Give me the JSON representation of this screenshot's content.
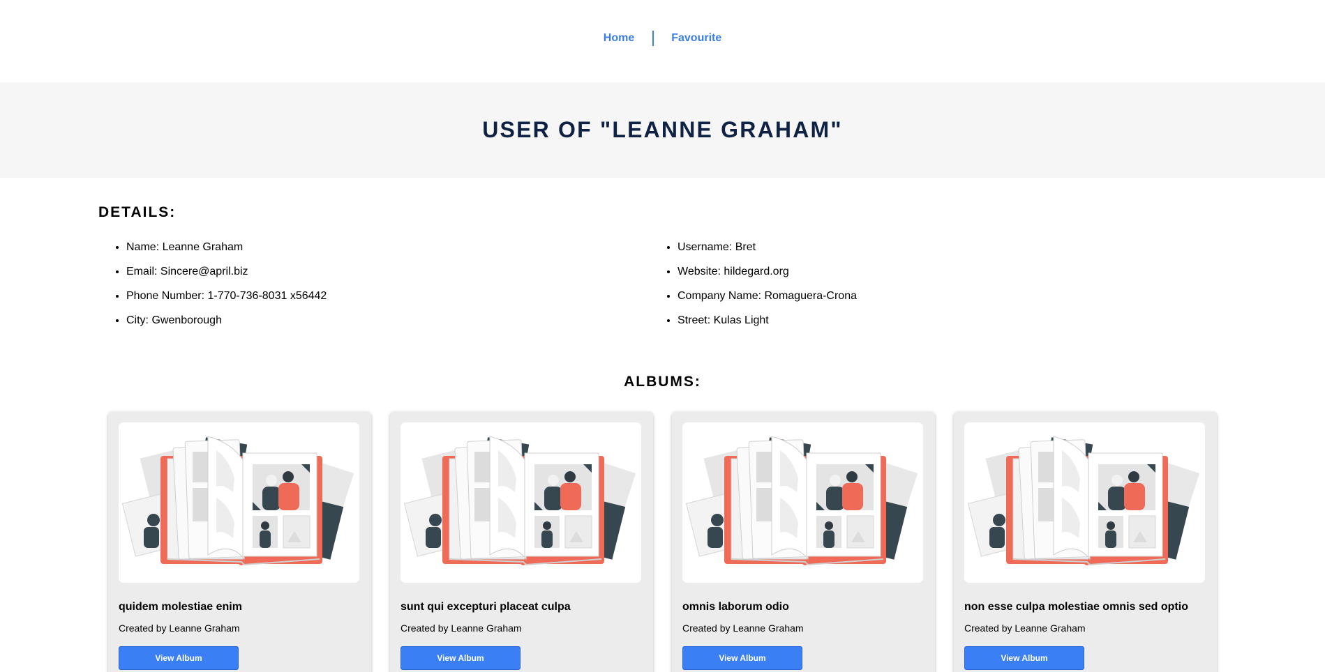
{
  "nav": {
    "home_label": "Home",
    "favourite_label": "Favourite"
  },
  "banner": {
    "title": "USER OF \"LEANNE GRAHAM\""
  },
  "details": {
    "heading": "DETAILS:",
    "left": [
      "Name: Leanne Graham",
      "Email: Sincere@april.biz",
      "Phone Number: 1-770-736-8031 x56442",
      "City: Gwenborough"
    ],
    "right": [
      "Username: Bret",
      "Website: hildegard.org",
      "Company Name: Romaguera-Crona",
      "Street: Kulas Light"
    ]
  },
  "albums": {
    "heading": "ALBUMS:",
    "items": [
      {
        "title": "quidem molestiae enim",
        "created_by": "Created by Leanne Graham",
        "button_label": "View Album",
        "image_icon": "photo-album-illustration"
      },
      {
        "title": "sunt qui excepturi placeat culpa",
        "created_by": "Created by Leanne Graham",
        "button_label": "View Album",
        "image_icon": "photo-album-illustration"
      },
      {
        "title": "omnis laborum odio",
        "created_by": "Created by Leanne Graham",
        "button_label": "View Album",
        "image_icon": "photo-album-illustration"
      },
      {
        "title": "non esse culpa molestiae omnis sed optio",
        "created_by": "Created by Leanne Graham",
        "button_label": "View Album",
        "image_icon": "photo-album-illustration"
      }
    ]
  },
  "colors": {
    "link": "#3b7ee8",
    "title": "#0f2244",
    "button": "#3b7ff5",
    "banner_bg": "#f6f6f6",
    "card_bg": "#ececec",
    "accent_red": "#ef6b57",
    "accent_dark": "#37474f"
  }
}
